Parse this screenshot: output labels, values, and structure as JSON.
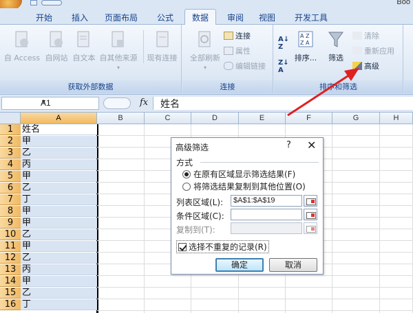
{
  "window": {
    "title_fragment": "Boo"
  },
  "tabs": [
    {
      "label": "开始"
    },
    {
      "label": "插入"
    },
    {
      "label": "页面布局"
    },
    {
      "label": "公式"
    },
    {
      "label": "数据",
      "active": true
    },
    {
      "label": "审阅"
    },
    {
      "label": "视图"
    },
    {
      "label": "开发工具"
    }
  ],
  "ribbon": {
    "external_data": {
      "label": "获取外部数据",
      "buttons": [
        "自 Access",
        "自网站",
        "自文本",
        "自其他来源",
        "现有连接"
      ]
    },
    "connections": {
      "label": "连接",
      "refresh_all": "全部刷新",
      "connections": "连接",
      "properties": "属性",
      "edit_links": "编辑链接"
    },
    "sort_filter": {
      "label": "排序和筛选",
      "sort": "排序...",
      "filter": "筛选",
      "clear": "清除",
      "reapply": "重新应用",
      "advanced": "高级"
    }
  },
  "formula_bar": {
    "name_box": "A1",
    "fx": "fx",
    "content": "姓名"
  },
  "grid": {
    "columns": [
      "A",
      "B",
      "C",
      "D",
      "E",
      "F",
      "G",
      "H"
    ],
    "rows": [
      "1",
      "2",
      "3",
      "4",
      "5",
      "6",
      "7",
      "8",
      "9",
      "10",
      "11",
      "12",
      "13",
      "14",
      "15",
      "16"
    ],
    "col_a_values": [
      "姓名",
      "甲",
      "乙",
      "丙",
      "甲",
      "乙",
      "丁",
      "甲",
      "甲",
      "乙",
      "甲",
      "乙",
      "丙",
      "甲",
      "乙",
      "丁"
    ]
  },
  "dialog": {
    "title": "高级筛选",
    "help": "?",
    "close": "✕",
    "section": "方式",
    "radio_in_place": "在原有区域显示筛选结果(F)",
    "radio_copy": "将筛选结果复制到其他位置(O)",
    "list_range_label": "列表区域(L):",
    "list_range_value": "$A$1:$A$19",
    "criteria_range_label": "条件区域(C):",
    "criteria_range_value": "",
    "copy_to_label": "复制到(T):",
    "copy_to_value": "",
    "unique_label": "选择不重复的记录(R)",
    "ok": "确定",
    "cancel": "取消"
  },
  "colors": {
    "annotation_arrow": "#e02020",
    "selection_header": "#f1b963"
  }
}
